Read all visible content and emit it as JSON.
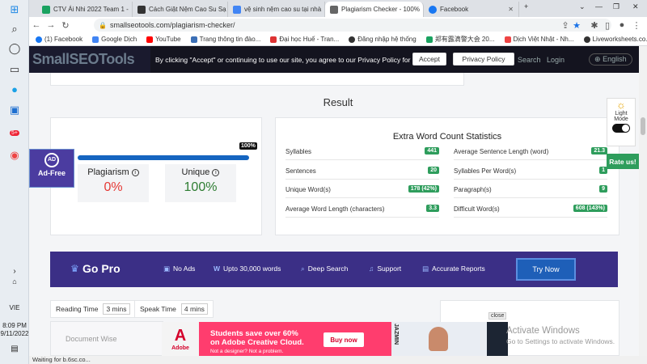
{
  "taskbar": {
    "time": "8:09 PM",
    "date": "9/11/2022",
    "lang": "VIE",
    "chat_badge": "5+",
    "icons": [
      "windows-icon",
      "search-icon",
      "task-view-icon",
      "widgets-icon",
      "edge-icon",
      "file-explorer-icon",
      "chat-icon",
      "chrome-icon"
    ]
  },
  "browser": {
    "tabs": [
      {
        "title": "CTV Ái Nhi 2022 Team 1 -",
        "color": "#1aa260"
      },
      {
        "title": "Cách Giặt Nệm Cao Su Sạ",
        "color": "#333333"
      },
      {
        "title": "vệ sinh nệm cao su tại nhà",
        "color": "#4285f4"
      },
      {
        "title": "Plagiarism Checker - 100%",
        "color": "#666666",
        "active": true
      },
      {
        "title": "Facebook",
        "color": "#1877f2"
      }
    ],
    "url": "smallseotools.com/plagiarism-checker/",
    "bookmarks": [
      {
        "label": "(1) Facebook",
        "color": "#1877f2"
      },
      {
        "label": "Google Dịch",
        "color": "#4285f4"
      },
      {
        "label": "YouTube",
        "color": "#ff0000"
      },
      {
        "label": "Trang thông tin đào...",
        "color": "#3b6fb6"
      },
      {
        "label": "Đại học Huế - Tran...",
        "color": "#d33"
      },
      {
        "label": "Đăng nhập hệ thống",
        "color": "#333"
      },
      {
        "label": "郑有露滴警大会 20...",
        "color": "#1aa260"
      },
      {
        "label": "Dịch Việt Nhật - Nh...",
        "color": "#e44"
      },
      {
        "label": "Liveworksheets.co...",
        "color": "#333"
      }
    ],
    "status": "Waiting for b.6sc.co..."
  },
  "site": {
    "logo": "SmallSEOTools",
    "cookie_message": "By clicking \"Accept\" or continuing to use our site, you agree to our Privacy Policy for Website",
    "accept_label": "Accept",
    "privacy_label": "Privacy Policy",
    "search_label": "Search",
    "login_label": "Login",
    "lang_label": "English",
    "result_title": "Result",
    "score_pct": "100%",
    "plagiarism_label": "Plagiarism",
    "plagiarism_value": "0%",
    "unique_label": "Unique",
    "unique_value": "100%",
    "adfree_icon": "AD",
    "adfree_label": "Ad-Free",
    "stats_title": "Extra Word Count Statistics",
    "stats_left": [
      {
        "name": "Syllables",
        "value": "441"
      },
      {
        "name": "Sentences",
        "value": "20"
      },
      {
        "name": "Unique Word(s)",
        "value": "178 (42%)"
      },
      {
        "name": "Average Word Length (characters)",
        "value": "3.3"
      }
    ],
    "stats_right": [
      {
        "name": "Average Sentence Length (word)",
        "value": "21.3"
      },
      {
        "name": "Syllables Per Word(s)",
        "value": "1"
      },
      {
        "name": "Paragraph(s)",
        "value": "9"
      },
      {
        "name": "Difficult Word(s)",
        "value": "608 (143%)"
      }
    ],
    "gopro": {
      "title": "Go Pro",
      "features": [
        {
          "icon": "image-icon",
          "label": "No Ads"
        },
        {
          "icon": "w-icon",
          "label": "Upto 30,000 words"
        },
        {
          "icon": "search-icon",
          "label": "Deep Search"
        },
        {
          "icon": "headset-icon",
          "label": "Support"
        },
        {
          "icon": "report-icon",
          "label": "Accurate Reports"
        }
      ],
      "cta": "Try Now"
    },
    "reading_time_label": "Reading Time",
    "reading_time_value": "3 mins",
    "speak_time_label": "Speak Time",
    "speak_time_value": "4 mins",
    "document_wise": "Document Wise",
    "light_mode_label": "Light Mode",
    "rate_us_label": "Rate us!"
  },
  "ad": {
    "close_label": "close",
    "logo_text": "Adobe",
    "headline_1": "Students save over 60%",
    "headline_2": "on Adobe Creative Cloud.",
    "sub": "Not a designer? Not a problem.",
    "cta": "Buy now",
    "side_text": "JAZMIN"
  },
  "os": {
    "activate_title": "Activate Windows",
    "activate_sub": "Go to Settings to activate Windows."
  }
}
